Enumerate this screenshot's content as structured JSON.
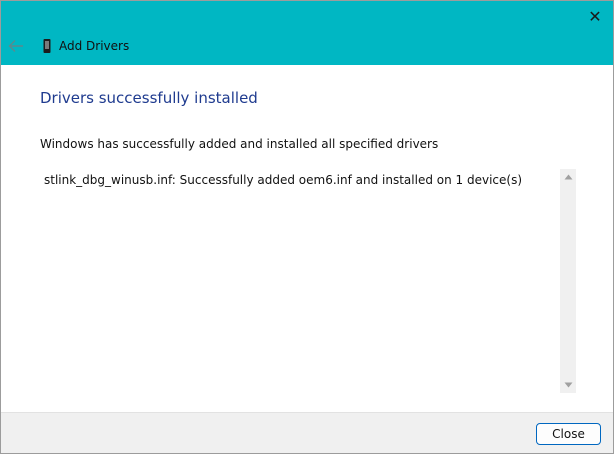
{
  "window": {
    "title": "Add Drivers",
    "close_glyph": "✕"
  },
  "icons": {
    "back": "back-arrow-icon",
    "app": "usb-device-icon",
    "close": "close-icon",
    "scroll_up": "chevron-up-icon",
    "scroll_down": "chevron-down-icon"
  },
  "main": {
    "heading": "Drivers successfully installed",
    "subtitle": "Windows has successfully added and installed all specified drivers",
    "results": [
      "stlink_dbg_winusb.inf: Successfully added oem6.inf and installed on 1 device(s)"
    ]
  },
  "footer": {
    "close_label": "Close"
  },
  "colors": {
    "titlebar": "#00b7c3",
    "heading": "#1f3b8f",
    "button_border": "#0067c0"
  }
}
